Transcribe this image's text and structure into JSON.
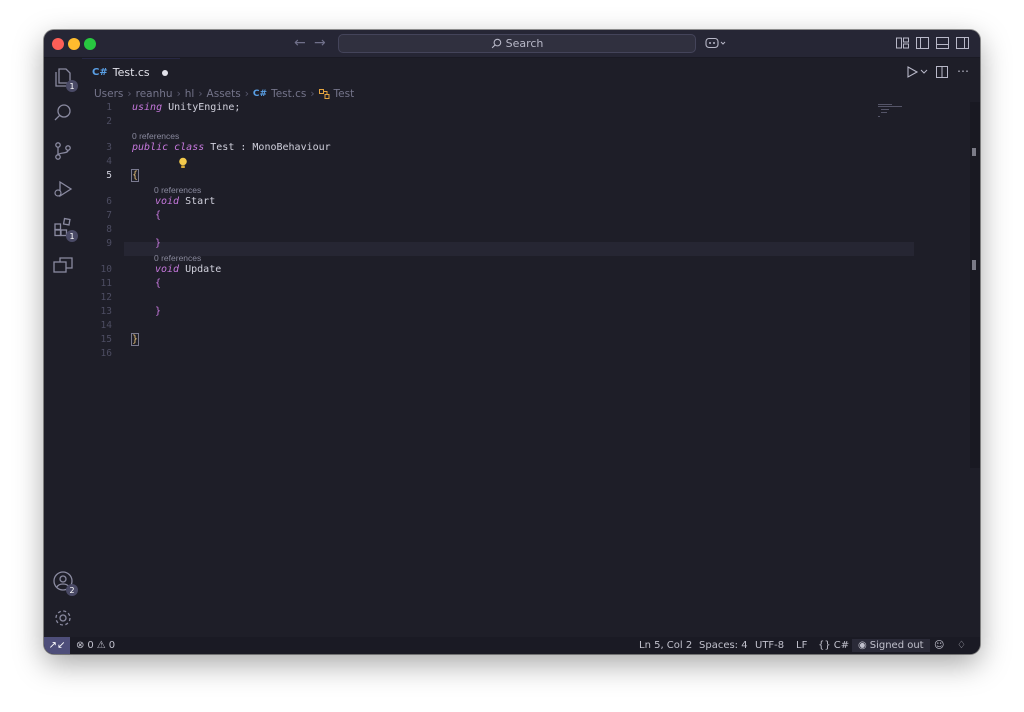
{
  "titlebar": {
    "search_label": "Search",
    "icons": [
      "back-arrow-icon",
      "forward-arrow-icon",
      "search-icon",
      "copilot-icon",
      "layout-customize-icon",
      "toggle-sidebar-icon",
      "toggle-panel-icon",
      "toggle-secondary-sidebar-icon"
    ]
  },
  "activity_bar": {
    "explorer_badge": "1",
    "extensions_badge": "1",
    "accounts_badge": "2"
  },
  "tabs": [
    {
      "label": "Test.cs",
      "modified": true
    }
  ],
  "breadcrumb": [
    "Users",
    "reanhu",
    "hl",
    "Assets",
    "Test.cs",
    "Test"
  ],
  "editor": {
    "line_numbers": [
      "1",
      "2",
      "3",
      "4",
      "5",
      "6",
      "7",
      "8",
      "9",
      "10",
      "11",
      "12",
      "13",
      "14",
      "15",
      "16"
    ],
    "active_line": "5",
    "codelens_text": "0 references",
    "lines": {
      "l1_kw": "using",
      "l1_rest": " UnityEngine;",
      "l3_kw": "public class",
      "l3_rest": " Test : MonoBehaviour",
      "l5": "{",
      "l6_kw": "void",
      "l6_rest": " Start",
      "l7": "{",
      "l9": "}",
      "l10_kw": "void",
      "l10_rest": " Update",
      "l11": "{",
      "l13": "}",
      "l15": "}"
    }
  },
  "statusbar": {
    "errors": "0",
    "warnings": "0",
    "cursor": "Ln 5, Col 2",
    "spaces": "Spaces: 4",
    "encoding": "UTF-8",
    "eol": "LF",
    "language": "C#",
    "signed_out": "Signed out"
  },
  "colors": {
    "editor_bg": "#1e1e28",
    "keyword": "#c678dd",
    "bracket_match": "#e5c07b",
    "csharp_icon": "#5aa0e6"
  }
}
